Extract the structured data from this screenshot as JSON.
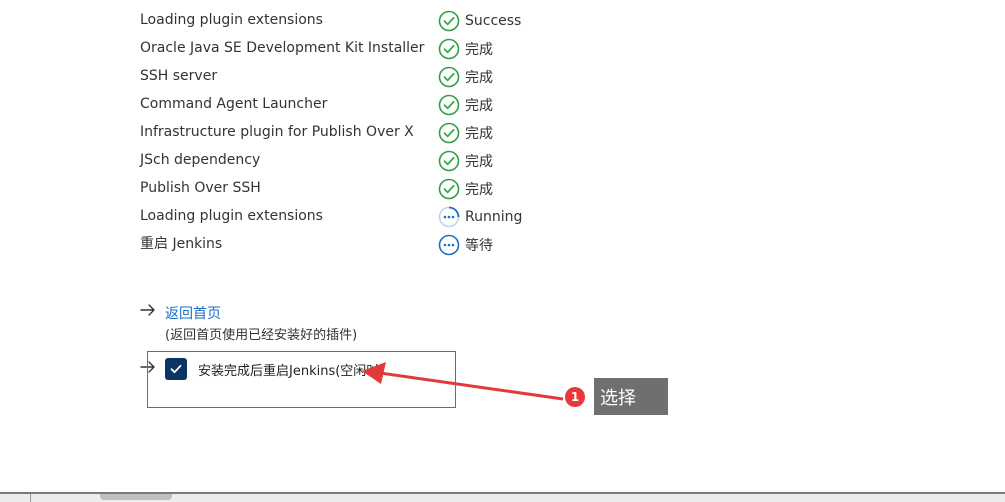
{
  "plugins": [
    {
      "name": "Loading plugin extensions",
      "status": "Success",
      "state": "done"
    },
    {
      "name": "Oracle Java SE Development Kit Installer",
      "status": "完成",
      "state": "done"
    },
    {
      "name": "SSH server",
      "status": "完成",
      "state": "done"
    },
    {
      "name": "Command Agent Launcher",
      "status": "完成",
      "state": "done"
    },
    {
      "name": "Infrastructure plugin for Publish Over X",
      "status": "完成",
      "state": "done"
    },
    {
      "name": "JSch dependency",
      "status": "完成",
      "state": "done"
    },
    {
      "name": "Publish Over SSH",
      "status": "完成",
      "state": "done"
    },
    {
      "name": "Loading plugin extensions",
      "status": "Running",
      "state": "running"
    },
    {
      "name": "重启 Jenkins",
      "status": "等待",
      "state": "pending"
    }
  ],
  "back": {
    "link_label": "返回首页",
    "note": "(返回首页使用已经安装好的插件)"
  },
  "restart": {
    "label": "安装完成后重启Jenkins(空闲时)",
    "checked": true
  },
  "annotation": {
    "badge": "1",
    "callout": "选择"
  },
  "colors": {
    "success": "#2ea043",
    "running": "#1a6fc4",
    "link": "#1a6fc4",
    "checkbox": "#0c3563",
    "annotation_red": "#e23a3a",
    "callout_bg": "#6f6f6f"
  },
  "icons": {
    "done": "check-circle-icon",
    "running": "spinner-dots-icon",
    "pending": "waiting-dots-icon",
    "arrow": "arrow-right-icon",
    "checkmark": "checkmark-icon"
  }
}
